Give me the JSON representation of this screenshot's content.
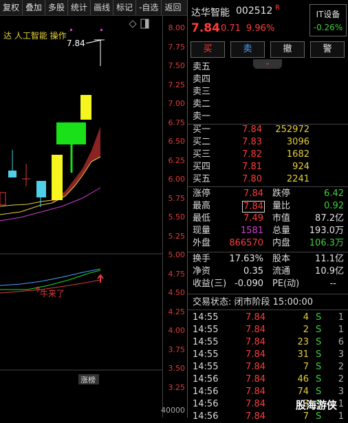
{
  "toolbar": {
    "items": [
      "复权",
      "叠加",
      "多股",
      "统计",
      "画线",
      "标记",
      "-自选",
      "返回"
    ]
  },
  "chart": {
    "concept_text": "达 人工智能  操作",
    "price_tag": "7.84",
    "signal_text": "牛来了",
    "limit_badge": "涨榜",
    "volume_axis_label": "40000",
    "price_levels": [
      "8.00",
      "7.75",
      "7.50",
      "7.25",
      "7.00",
      "6.75",
      "6.50",
      "6.25",
      "6.00",
      "5.75",
      "5.50",
      "5.25",
      "5.00",
      "4.75",
      "4.50",
      "4.25",
      "4.00",
      "3.75",
      "3.50",
      "3.25"
    ]
  },
  "stock": {
    "name": "达华智能",
    "code": "002512",
    "flag": "R",
    "price": "7.84",
    "change": "0.71",
    "pct": "9.96%",
    "sector_name": "IT设备",
    "sector_pct": "-0.26%"
  },
  "actions": {
    "buy": "买",
    "sell": "卖",
    "cancel": "撤",
    "alert": "警"
  },
  "orderbook": {
    "asks": [
      {
        "label": "卖五",
        "price": "",
        "vol": ""
      },
      {
        "label": "卖四",
        "price": "",
        "vol": ""
      },
      {
        "label": "卖三",
        "price": "",
        "vol": ""
      },
      {
        "label": "卖二",
        "price": "",
        "vol": ""
      },
      {
        "label": "卖一",
        "price": "",
        "vol": ""
      }
    ],
    "bids": [
      {
        "label": "买一",
        "price": "7.84",
        "vol": "252972"
      },
      {
        "label": "买二",
        "price": "7.83",
        "vol": "3096"
      },
      {
        "label": "买三",
        "price": "7.82",
        "vol": "1682"
      },
      {
        "label": "买四",
        "price": "7.81",
        "vol": "924"
      },
      {
        "label": "买五",
        "price": "7.80",
        "vol": "2241"
      }
    ]
  },
  "stats": [
    {
      "l1": "涨停",
      "v1": "7.84",
      "c1": "red",
      "l2": "跌停",
      "v2": "6.42",
      "c2": "green"
    },
    {
      "l1": "最高",
      "v1": "7.84",
      "c1": "red",
      "l2": "量比",
      "v2": "0.92",
      "c2": "green"
    },
    {
      "l1": "最低",
      "v1": "7.49",
      "c1": "red",
      "l2": "市值",
      "v2": "87.2亿",
      "c2": "white"
    },
    {
      "l1": "现量",
      "v1": "1581",
      "c1": "purple",
      "l2": "总量",
      "v2": "193.0万",
      "c2": "white"
    },
    {
      "l1": "外盘",
      "v1": "866570",
      "c1": "red",
      "l2": "内盘",
      "v2": "106.3万",
      "c2": "green"
    }
  ],
  "stats2": [
    {
      "l1": "换手",
      "v1": "17.63%",
      "c1": "white",
      "l2": "股本",
      "v2": "11.1亿",
      "c2": "white"
    },
    {
      "l1": "净资",
      "v1": "0.35",
      "c1": "white",
      "l2": "流通",
      "v2": "10.9亿",
      "c2": "white"
    },
    {
      "l1": "收益(三)",
      "v1": "-0.090",
      "c1": "white",
      "l2": "PE(动)",
      "v2": "--",
      "c2": "white"
    }
  ],
  "trade_status": "交易状态: 闭市阶段 15:00:00",
  "ticks": [
    {
      "time": "14:55",
      "price": "7.84",
      "vol": "4",
      "side": "S",
      "n": "1"
    },
    {
      "time": "14:55",
      "price": "7.84",
      "vol": "2",
      "side": "S",
      "n": "1"
    },
    {
      "time": "14:55",
      "price": "7.84",
      "vol": "23",
      "side": "S",
      "n": "6"
    },
    {
      "time": "14:55",
      "price": "7.84",
      "vol": "31",
      "side": "S",
      "n": "3"
    },
    {
      "time": "14:55",
      "price": "7.84",
      "vol": "7",
      "side": "S",
      "n": "2"
    },
    {
      "time": "14:56",
      "price": "7.84",
      "vol": "46",
      "side": "S",
      "n": "2"
    },
    {
      "time": "14:56",
      "price": "7.84",
      "vol": "74",
      "side": "S",
      "n": "3"
    },
    {
      "time": "14:56",
      "price": "7.84",
      "vol": "3",
      "side": "S",
      "n": "1"
    },
    {
      "time": "14:56",
      "price": "7.84",
      "vol": "7",
      "side": "S",
      "n": "1"
    }
  ],
  "watermark": "股海游侠",
  "colors": {
    "up": "#ff3c3c",
    "down": "#3fd13f",
    "candle_yellow": "#f5f520",
    "candle_green": "#19e019",
    "band": "#8b2323",
    "ma_purple": "#d040d0",
    "cyan": "#4fd0e8"
  }
}
